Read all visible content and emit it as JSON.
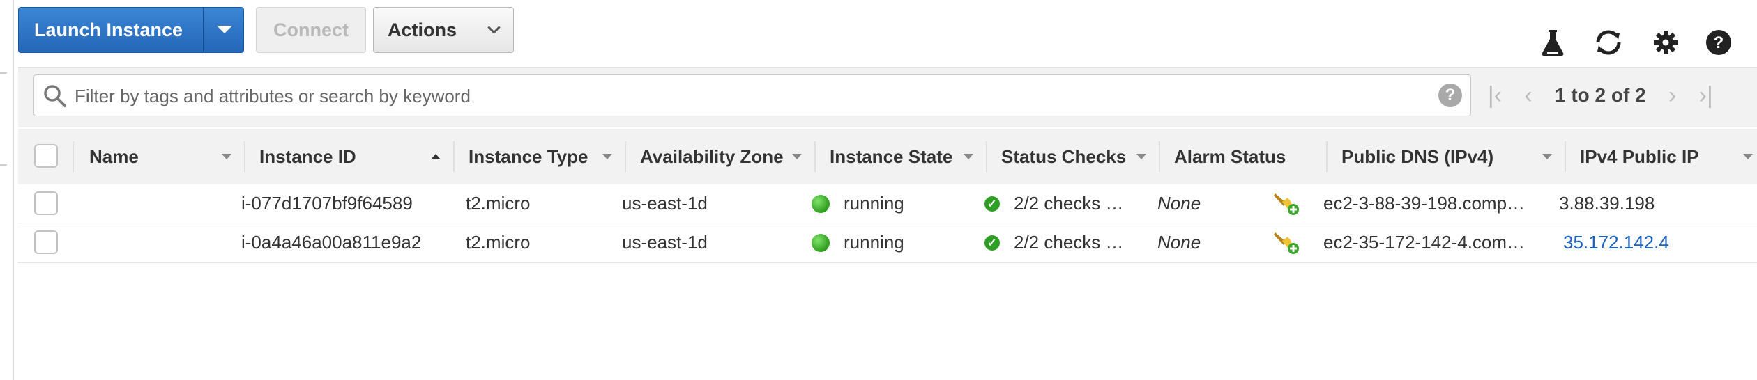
{
  "toolbar": {
    "launch_label": "Launch Instance",
    "connect_label": "Connect",
    "actions_label": "Actions"
  },
  "icons": {
    "top_right": [
      "flask-icon",
      "refresh-icon",
      "gear-icon",
      "help-icon"
    ]
  },
  "filter": {
    "placeholder": "Filter by tags and attributes or search by keyword",
    "pagination": "1 to 2 of 2"
  },
  "table": {
    "columns": [
      "Name",
      "Instance ID",
      "Instance Type",
      "Availability Zone",
      "Instance State",
      "Status Checks",
      "Alarm Status",
      "Public DNS (IPv4)",
      "IPv4 Public IP"
    ],
    "rows": [
      {
        "name": "",
        "instance_id": "i-077d1707bf9f64589",
        "instance_type": "t2.micro",
        "availability_zone": "us-east-1d",
        "instance_state": "running",
        "status_checks": "2/2 checks …",
        "alarm_status": "None",
        "public_dns": "ec2-3-88-39-198.comp…",
        "public_ip": "3.88.39.198"
      },
      {
        "name": "",
        "instance_id": "i-0a4a46a00a811e9a2",
        "instance_type": "t2.micro",
        "availability_zone": "us-east-1d",
        "instance_state": "running",
        "status_checks": "2/2 checks …",
        "alarm_status": "None",
        "public_dns": "ec2-35-172-142-4.com…",
        "public_ip": "35.172.142.4"
      }
    ]
  },
  "colors": {
    "primary_button": "#2466b8",
    "running": "#3aa82a",
    "link": "#1a62c4"
  }
}
